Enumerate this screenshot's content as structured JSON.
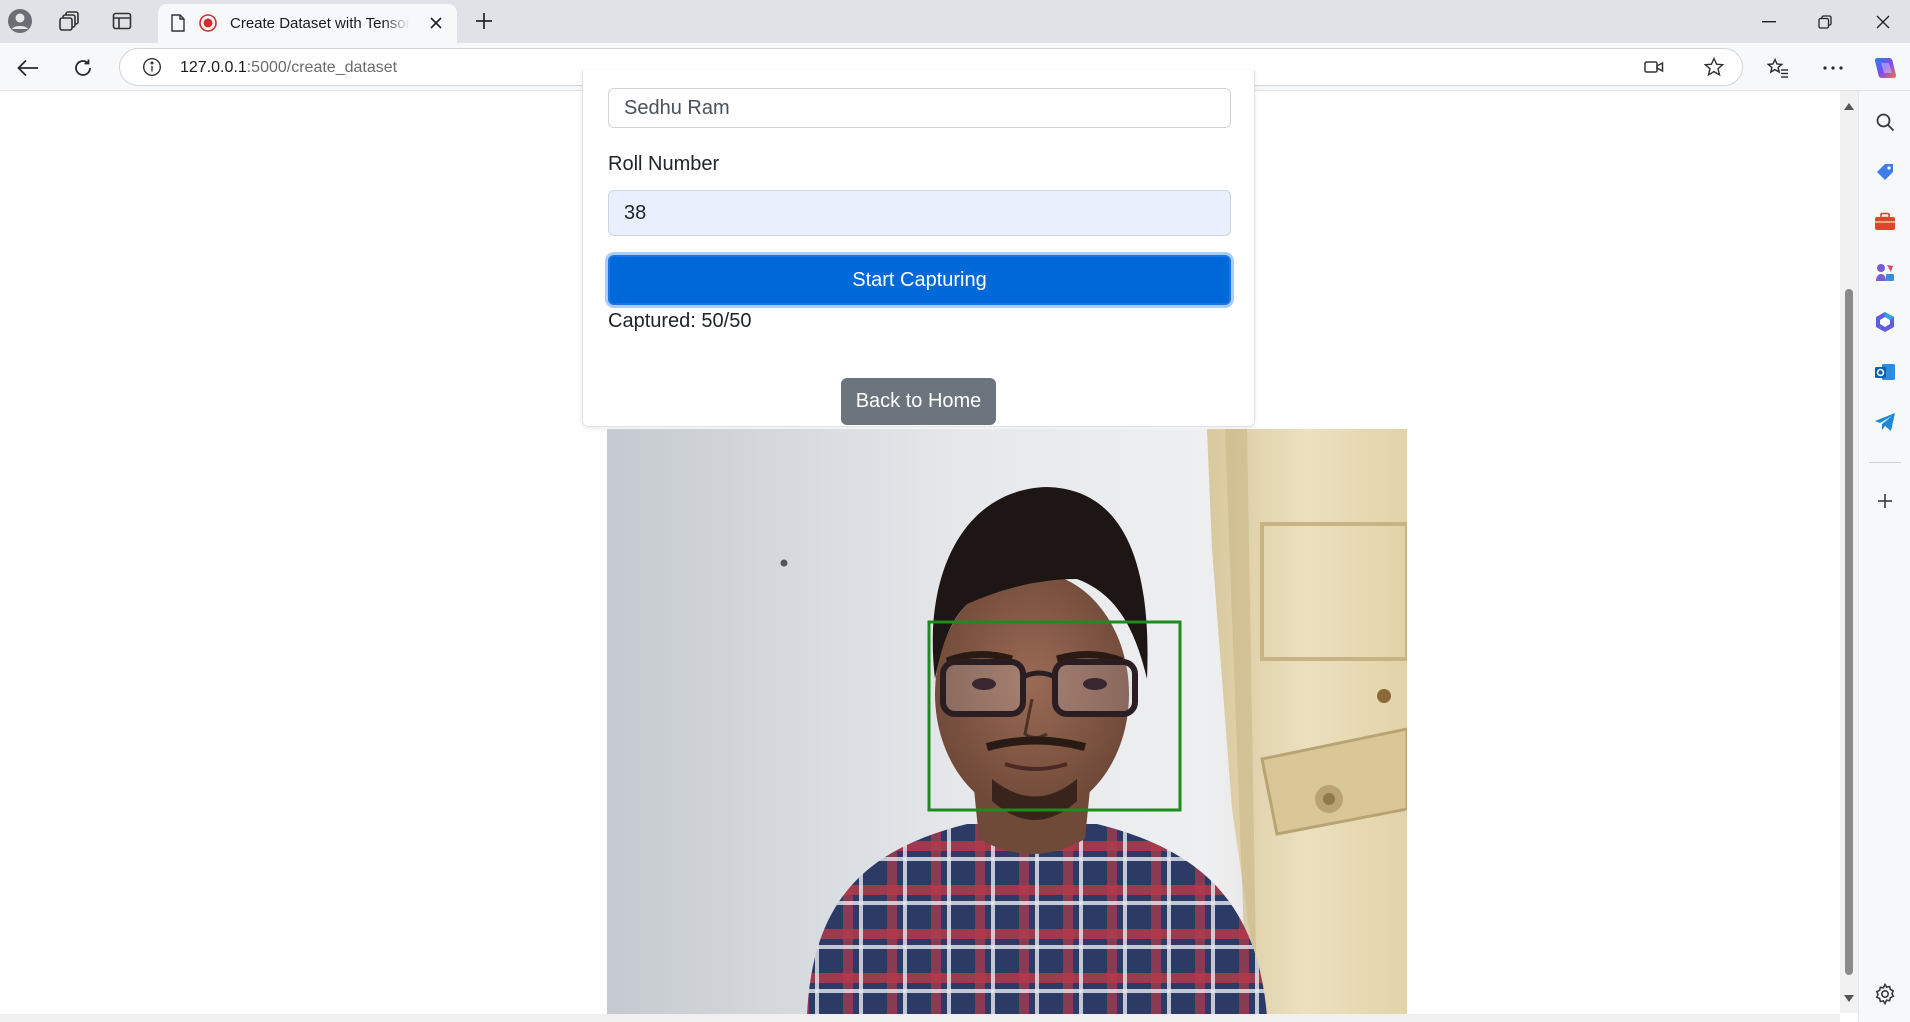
{
  "browser": {
    "tab_title": "Create Dataset with TensorFlow",
    "url_host": "127.0.0.1",
    "url_path": ":5000/create_dataset"
  },
  "form": {
    "name_value": "Sedhu Ram",
    "roll_label": "Roll Number",
    "roll_value": "38",
    "start_button": "Start Capturing",
    "status_text": "Captured: 50/50",
    "back_button": "Back to Home"
  },
  "colors": {
    "primary": "#0069d9",
    "secondary": "#6c757d",
    "face_box": "#1f8b1f"
  },
  "icons": {
    "titlebar": [
      "profile-icon",
      "workspaces-icon",
      "vertical-tabs-icon",
      "page-icon",
      "recording-icon",
      "close-icon",
      "new-tab-icon"
    ],
    "window": [
      "minimize-icon",
      "restore-icon",
      "close-window-icon"
    ],
    "toolbar": [
      "back-icon",
      "refresh-icon",
      "site-info-icon",
      "camera-in-use-icon",
      "favorite-icon",
      "favorites-icon",
      "more-icon",
      "copilot-icon"
    ],
    "sidebar": [
      "search-icon",
      "shopping-icon",
      "tools-icon",
      "games-icon",
      "microsoft365-icon",
      "outlook-icon",
      "telegram-icon",
      "add-icon",
      "settings-icon"
    ]
  }
}
